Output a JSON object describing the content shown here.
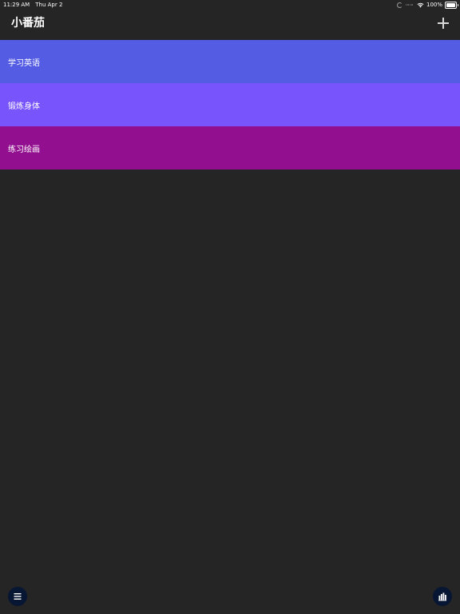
{
  "status_bar": {
    "time": "11:29 AM",
    "date": "Thu Apr 2",
    "battery": "100%",
    "icons": [
      "sync-icon",
      "cellular-icon",
      "wifi-icon",
      "battery-icon"
    ]
  },
  "nav": {
    "title": "小番茄",
    "add_icon": "plus-icon"
  },
  "tasks": [
    {
      "label": "学习英语",
      "color": "#545ce4"
    },
    {
      "label": "锻炼身体",
      "color": "#7754fc"
    },
    {
      "label": "练习绘画",
      "color": "#920f8f"
    }
  ],
  "bottom": {
    "menu_icon": "menu-icon",
    "stats_icon": "bar-chart-icon",
    "button_color": "#061633"
  },
  "colors": {
    "background": "#252525",
    "text": "#ffffff"
  }
}
